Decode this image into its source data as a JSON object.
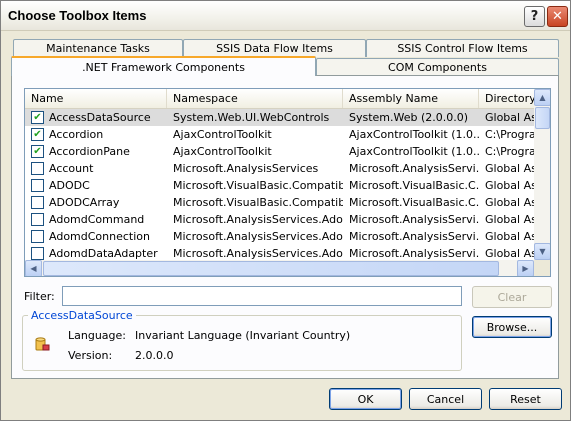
{
  "window": {
    "title": "Choose Toolbox Items",
    "help_glyph": "?",
    "close_glyph": "✕"
  },
  "tabs": {
    "row1": [
      "Maintenance Tasks",
      "SSIS Data Flow Items",
      "SSIS Control Flow Items"
    ],
    "row2": [
      ".NET Framework Components",
      "COM Components"
    ],
    "selected": ".NET Framework Components"
  },
  "list": {
    "columns": [
      "Name",
      "Namespace",
      "Assembly Name",
      "Directory"
    ],
    "rows": [
      {
        "checked": true,
        "name": "AccessDataSource",
        "namespace": "System.Web.UI.WebControls",
        "assembly": "System.Web (2.0.0.0)",
        "directory": "Global Ass",
        "selected": true
      },
      {
        "checked": true,
        "name": "Accordion",
        "namespace": "AjaxControlToolkit",
        "assembly": "AjaxControlToolkit (1.0...",
        "directory": "C:\\Progra"
      },
      {
        "checked": true,
        "name": "AccordionPane",
        "namespace": "AjaxControlToolkit",
        "assembly": "AjaxControlToolkit (1.0...",
        "directory": "C:\\Progra"
      },
      {
        "checked": false,
        "name": "Account",
        "namespace": "Microsoft.AnalysisServices",
        "assembly": "Microsoft.AnalysisServi...",
        "directory": "Global Ass"
      },
      {
        "checked": false,
        "name": "ADODC",
        "namespace": "Microsoft.VisualBasic.Compatibi...",
        "assembly": "Microsoft.VisualBasic.C...",
        "directory": "Global Ass"
      },
      {
        "checked": false,
        "name": "ADODCArray",
        "namespace": "Microsoft.VisualBasic.Compatibi...",
        "assembly": "Microsoft.VisualBasic.C...",
        "directory": "Global Ass"
      },
      {
        "checked": false,
        "name": "AdomdCommand",
        "namespace": "Microsoft.AnalysisServices.Ado...",
        "assembly": "Microsoft.AnalysisServi...",
        "directory": "Global Ass"
      },
      {
        "checked": false,
        "name": "AdomdConnection",
        "namespace": "Microsoft.AnalysisServices.Ado...",
        "assembly": "Microsoft.AnalysisServi...",
        "directory": "Global Ass"
      },
      {
        "checked": false,
        "name": "AdomdDataAdapter",
        "namespace": "Microsoft.AnalysisServices.Ado...",
        "assembly": "Microsoft.AnalysisServi...",
        "directory": "Global Ass"
      }
    ],
    "scroll_up_glyph": "▲",
    "scroll_down_glyph": "▼",
    "scroll_left_glyph": "◀",
    "scroll_right_glyph": "▶",
    "check_glyph": "✔"
  },
  "filter": {
    "label": "Filter:",
    "value": "",
    "clear_label": "Clear"
  },
  "details": {
    "group_title": "AccessDataSource",
    "language_label": "Language:",
    "language_value": "Invariant Language (Invariant Country)",
    "version_label": "Version:",
    "version_value": "2.0.0.0",
    "browse_label": "Browse..."
  },
  "footer": {
    "ok_label": "OK",
    "cancel_label": "Cancel",
    "reset_label": "Reset"
  }
}
